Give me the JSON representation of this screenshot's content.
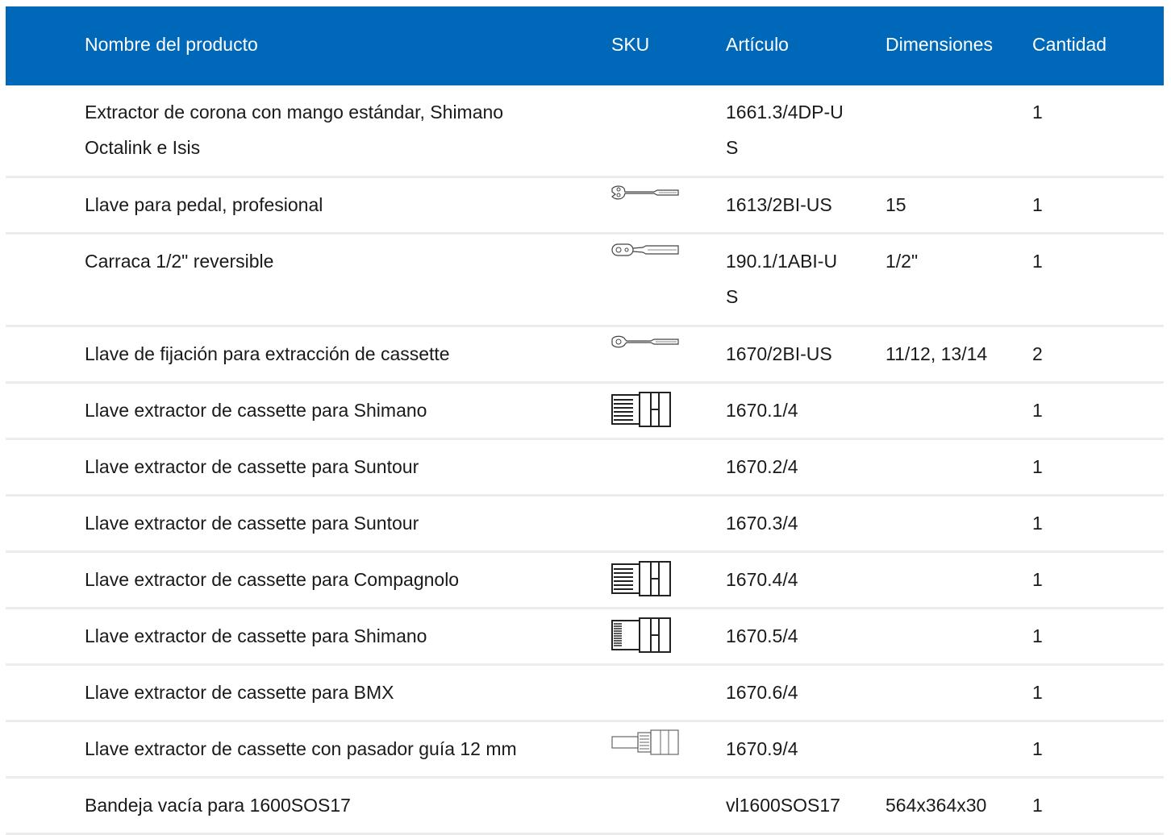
{
  "table": {
    "headers": {
      "name": "Nombre del producto",
      "sku": "SKU",
      "article": "Artículo",
      "dimensions": "Dimensiones",
      "quantity": "Cantidad"
    },
    "rows": [
      {
        "name": "Extractor de corona con mango estándar, Shimano Octalink e Isis",
        "image": "",
        "article": "1661.3/4DP-US",
        "dimensions": "",
        "quantity": "1"
      },
      {
        "name": "Llave para pedal, profesional",
        "image": "pedal-wrench-icon",
        "article": "1613/2BI-US",
        "dimensions": "15",
        "quantity": "1"
      },
      {
        "name": "Carraca 1/2\" reversible",
        "image": "ratchet-icon",
        "article": "190.1/1ABI-US",
        "dimensions": "1/2\"",
        "quantity": "1"
      },
      {
        "name": "Llave de fijación para extracción de cassette",
        "image": "chain-whip-icon",
        "article": "1670/2BI-US",
        "dimensions": "11/12, 13/14",
        "quantity": "2"
      },
      {
        "name": "Llave extractor de cassette para Shimano",
        "image": "cassette-socket-icon",
        "article": "1670.1/4",
        "dimensions": "",
        "quantity": "1"
      },
      {
        "name": "Llave extractor de cassette para Suntour",
        "image": "",
        "article": "1670.2/4",
        "dimensions": "",
        "quantity": "1"
      },
      {
        "name": "Llave extractor de cassette para Suntour",
        "image": "",
        "article": "1670.3/4",
        "dimensions": "",
        "quantity": "1"
      },
      {
        "name": "Llave extractor de cassette para Compagnolo",
        "image": "cassette-socket-icon",
        "article": "1670.4/4",
        "dimensions": "",
        "quantity": "1"
      },
      {
        "name": "Llave extractor de cassette para Shimano",
        "image": "cassette-socket-dense-icon",
        "article": "1670.5/4",
        "dimensions": "",
        "quantity": "1"
      },
      {
        "name": "Llave extractor de cassette para BMX",
        "image": "",
        "article": "1670.6/4",
        "dimensions": "",
        "quantity": "1"
      },
      {
        "name": "Llave extractor de cassette con pasador guía 12 mm",
        "image": "guide-pin-socket-icon",
        "article": "1670.9/4",
        "dimensions": "",
        "quantity": "1"
      },
      {
        "name": "Bandeja vacía para 1600SOS17",
        "image": "",
        "article": "vl1600SOS17",
        "dimensions": "564x364x30",
        "quantity": "1"
      }
    ]
  },
  "colors": {
    "header_bg": "#0068b9",
    "header_text": "#ffffff",
    "row_border": "#ececec",
    "text": "#1a1a1a"
  }
}
